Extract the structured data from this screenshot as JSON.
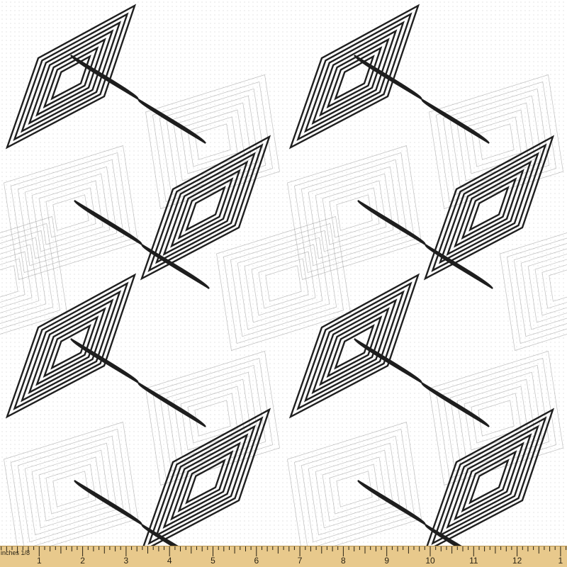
{
  "fabric": {
    "pattern": "interlocking diamond and leaf line-art geometric print",
    "colors": {
      "background": "#ffffff",
      "dot_texture": "#e9e9e9",
      "bold_line": "#1f1f1f",
      "fine_line": "#8a8a8a"
    }
  },
  "ruler": {
    "unit_label": "inches 1/8",
    "numbers": [
      "1",
      "2",
      "3",
      "4",
      "5",
      "6",
      "7",
      "8",
      "9",
      "10",
      "11",
      "12",
      "1"
    ],
    "colors": {
      "wood": "#e8c98c",
      "wood_edge": "#b9954f",
      "ink": "#2a2416"
    }
  }
}
